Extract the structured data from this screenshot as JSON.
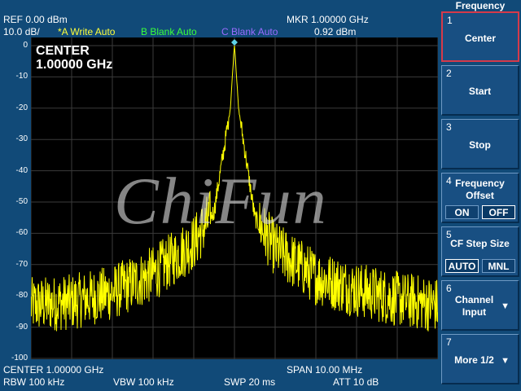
{
  "header": {
    "ref": "REF  0.00 dBm",
    "scale": "10.0 dB/",
    "trace_a": "*A Write Auto",
    "trace_b": "B Blank Auto",
    "trace_c": "C Blank Auto",
    "marker_freq": "MKR 1.00000 GHz",
    "marker_level": "0.92 dBm",
    "colors": {
      "trace_a": "#ffff3a",
      "trace_b": "#3aff3a",
      "trace_c": "#9a6cff"
    }
  },
  "plot": {
    "y_ticks": [
      "0",
      "-10",
      "-20",
      "-30",
      "-40",
      "-50",
      "-60",
      "-70",
      "-80",
      "-90",
      "-100"
    ],
    "center_label": "CENTER",
    "center_value": "1.00000 GHz",
    "watermark": "ChiFun",
    "trace_color": "#ffff00",
    "marker_color": "#5fd3e8"
  },
  "footer": {
    "center": "CENTER 1.00000 GHz",
    "span": "SPAN 10.00 MHz",
    "rbw": "RBW 100 kHz",
    "vbw": "VBW  100 kHz",
    "swp": "SWP  20 ms",
    "att": "ATT 10 dB"
  },
  "softkeys": {
    "title": "Frequency",
    "items": [
      {
        "num": "1",
        "label": "Center"
      },
      {
        "num": "2",
        "label": "Start"
      },
      {
        "num": "3",
        "label": "Stop"
      },
      {
        "num": "4",
        "label_line1": "Frequency",
        "label_line2": "Offset",
        "opt_on": "ON",
        "opt_off": "OFF"
      },
      {
        "num": "5",
        "label": "CF Step Size",
        "opt_auto": "AUTO",
        "opt_mnl": "MNL"
      },
      {
        "num": "6",
        "label_line1": "Channel",
        "label_line2": "Input"
      },
      {
        "num": "7",
        "label": "More 1/2"
      }
    ]
  },
  "chart_data": {
    "type": "line",
    "xlabel": "",
    "ylabel": "",
    "x_range_ghz": [
      0.995,
      1.005
    ],
    "ylim": [
      -100,
      0
    ],
    "y_unit": "dBm",
    "grid": true,
    "series": [
      {
        "x": [
          0.995,
          0.996,
          0.997,
          0.998,
          0.999,
          0.9995,
          0.9999,
          1.0,
          1.0001,
          1.0005,
          1.001,
          1.002,
          1.003,
          1.004,
          1.005
        ],
        "y": [
          -83,
          -82,
          -79,
          -73,
          -63,
          -53,
          -20,
          0.92,
          -20,
          -55,
          -65,
          -74,
          -78,
          -81,
          -83
        ]
      }
    ],
    "marker": {
      "x": 1.0,
      "y": 0.92
    }
  }
}
